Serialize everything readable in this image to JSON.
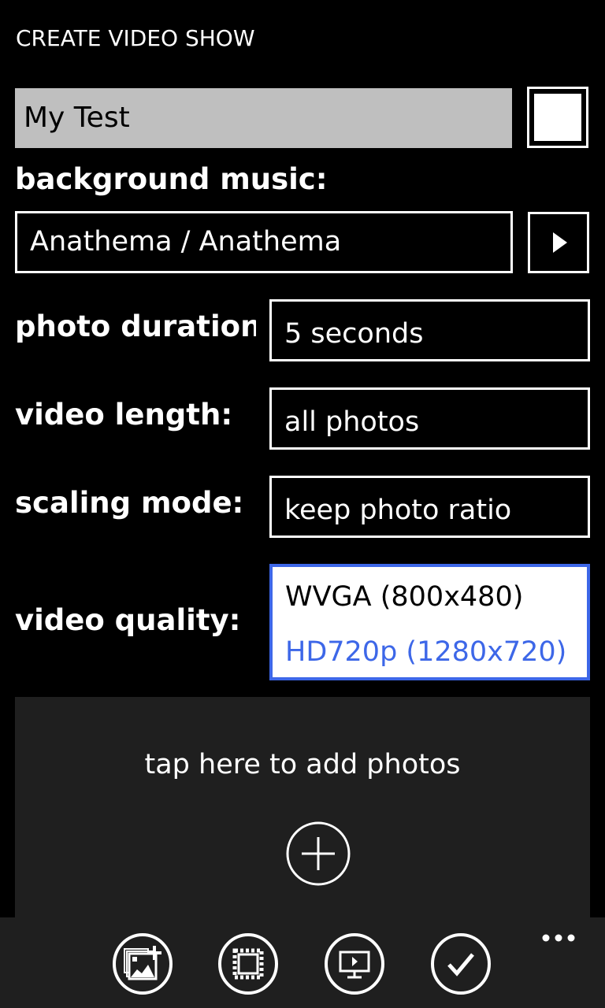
{
  "header": {
    "title": "CREATE VIDEO SHOW"
  },
  "show_name": {
    "value": "My Test",
    "checkbox_checked": false
  },
  "background_music": {
    "label": "background music:",
    "value": "Anathema / Anathema",
    "play_icon": "play-icon"
  },
  "photo_duration": {
    "label": "photo duration:",
    "value": "5 seconds"
  },
  "video_length": {
    "label": "video length:",
    "value": "all photos"
  },
  "scaling_mode": {
    "label": "scaling mode:",
    "value": "keep photo ratio"
  },
  "video_quality": {
    "label": "video quality:",
    "options": [
      {
        "label": "WVGA (800x480)",
        "selected": false
      },
      {
        "label": "HD720p (1280x720)",
        "selected": true
      }
    ]
  },
  "photos": {
    "hint": "tap here to add photos",
    "add_icon": "add-circle-icon"
  },
  "appbar": {
    "buttons": [
      {
        "name": "add-photos",
        "icon": "add-photos-icon"
      },
      {
        "name": "frame",
        "icon": "frame-icon"
      },
      {
        "name": "preview",
        "icon": "preview-monitor-icon"
      },
      {
        "name": "save",
        "icon": "check-icon"
      }
    ],
    "more_icon": "ellipsis-icon"
  },
  "colors": {
    "accent": "#3d67e8",
    "background": "#000000",
    "panel": "#1f1f1f",
    "name_box": "#bfbfbf"
  }
}
